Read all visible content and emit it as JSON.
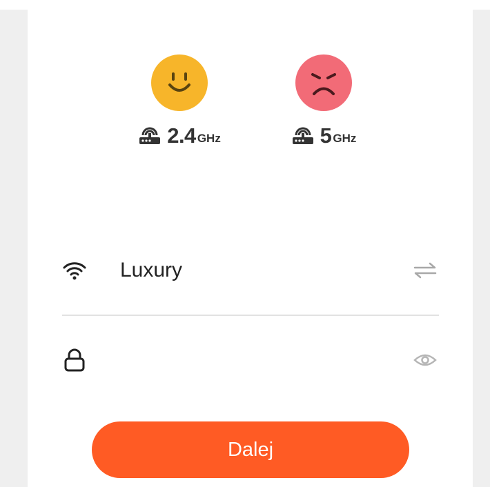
{
  "bands": {
    "band_24": {
      "value": "2.4",
      "unit": "GHz",
      "status": "good"
    },
    "band_5": {
      "value": "5",
      "unit": "GHz",
      "status": "bad"
    }
  },
  "wifi": {
    "ssid": "Luxury",
    "password_placeholder": ""
  },
  "next_button": {
    "label": "Dalej"
  },
  "colors": {
    "accent": "#ff5b24",
    "happy_face": "#f7b52a",
    "sad_face": "#f26b77"
  },
  "icons": [
    "smiley-happy-icon",
    "smiley-sad-icon",
    "router-icon",
    "wifi-icon",
    "swap-icon",
    "lock-icon",
    "eye-icon"
  ]
}
